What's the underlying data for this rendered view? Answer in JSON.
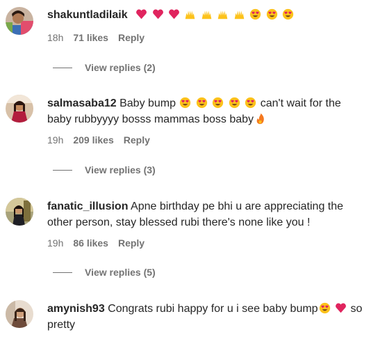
{
  "comments": [
    {
      "username": "shakuntladilaik",
      "text_before": "",
      "text_after": "",
      "emojis": [
        "red-heart",
        "red-heart",
        "red-heart",
        "raising-hands",
        "raising-hands",
        "raising-hands",
        "raising-hands",
        "heart-eyes",
        "heart-eyes",
        "heart-eyes"
      ],
      "time": "18h",
      "likes": "71 likes",
      "reply_label": "Reply",
      "view_replies": "View replies (2)"
    },
    {
      "username": "salmasaba12",
      "text_before": "Baby bump",
      "text_after": "can't wait for the",
      "line2": "baby rubbyyyy bosss mammas boss baby",
      "emojis": [
        "heart-eyes",
        "heart-eyes",
        "heart-eyes",
        "heart-eyes",
        "heart-eyes"
      ],
      "emojis_end": [
        "fire"
      ],
      "time": "19h",
      "likes": "209 likes",
      "reply_label": "Reply",
      "view_replies": "View replies (3)"
    },
    {
      "username": "fanatic_illusion",
      "text_before": "Apne birthday pe bhi u are appreciating the",
      "line2": "other person, stay blessed rubi there's none like you !",
      "time": "19h",
      "likes": "86 likes",
      "reply_label": "Reply",
      "view_replies": "View replies (5)"
    },
    {
      "username": "amynish93",
      "text_before": "Congrats rubi happy for u i see baby bump",
      "emojis": [
        "heart-eyes",
        "red-heart"
      ],
      "text_after": "so",
      "line2": "pretty"
    }
  ],
  "colors": {
    "text": "#262626",
    "secondary": "#737373",
    "heart_red": "#e0245e",
    "emoji_yellow": "#fcc21b"
  }
}
